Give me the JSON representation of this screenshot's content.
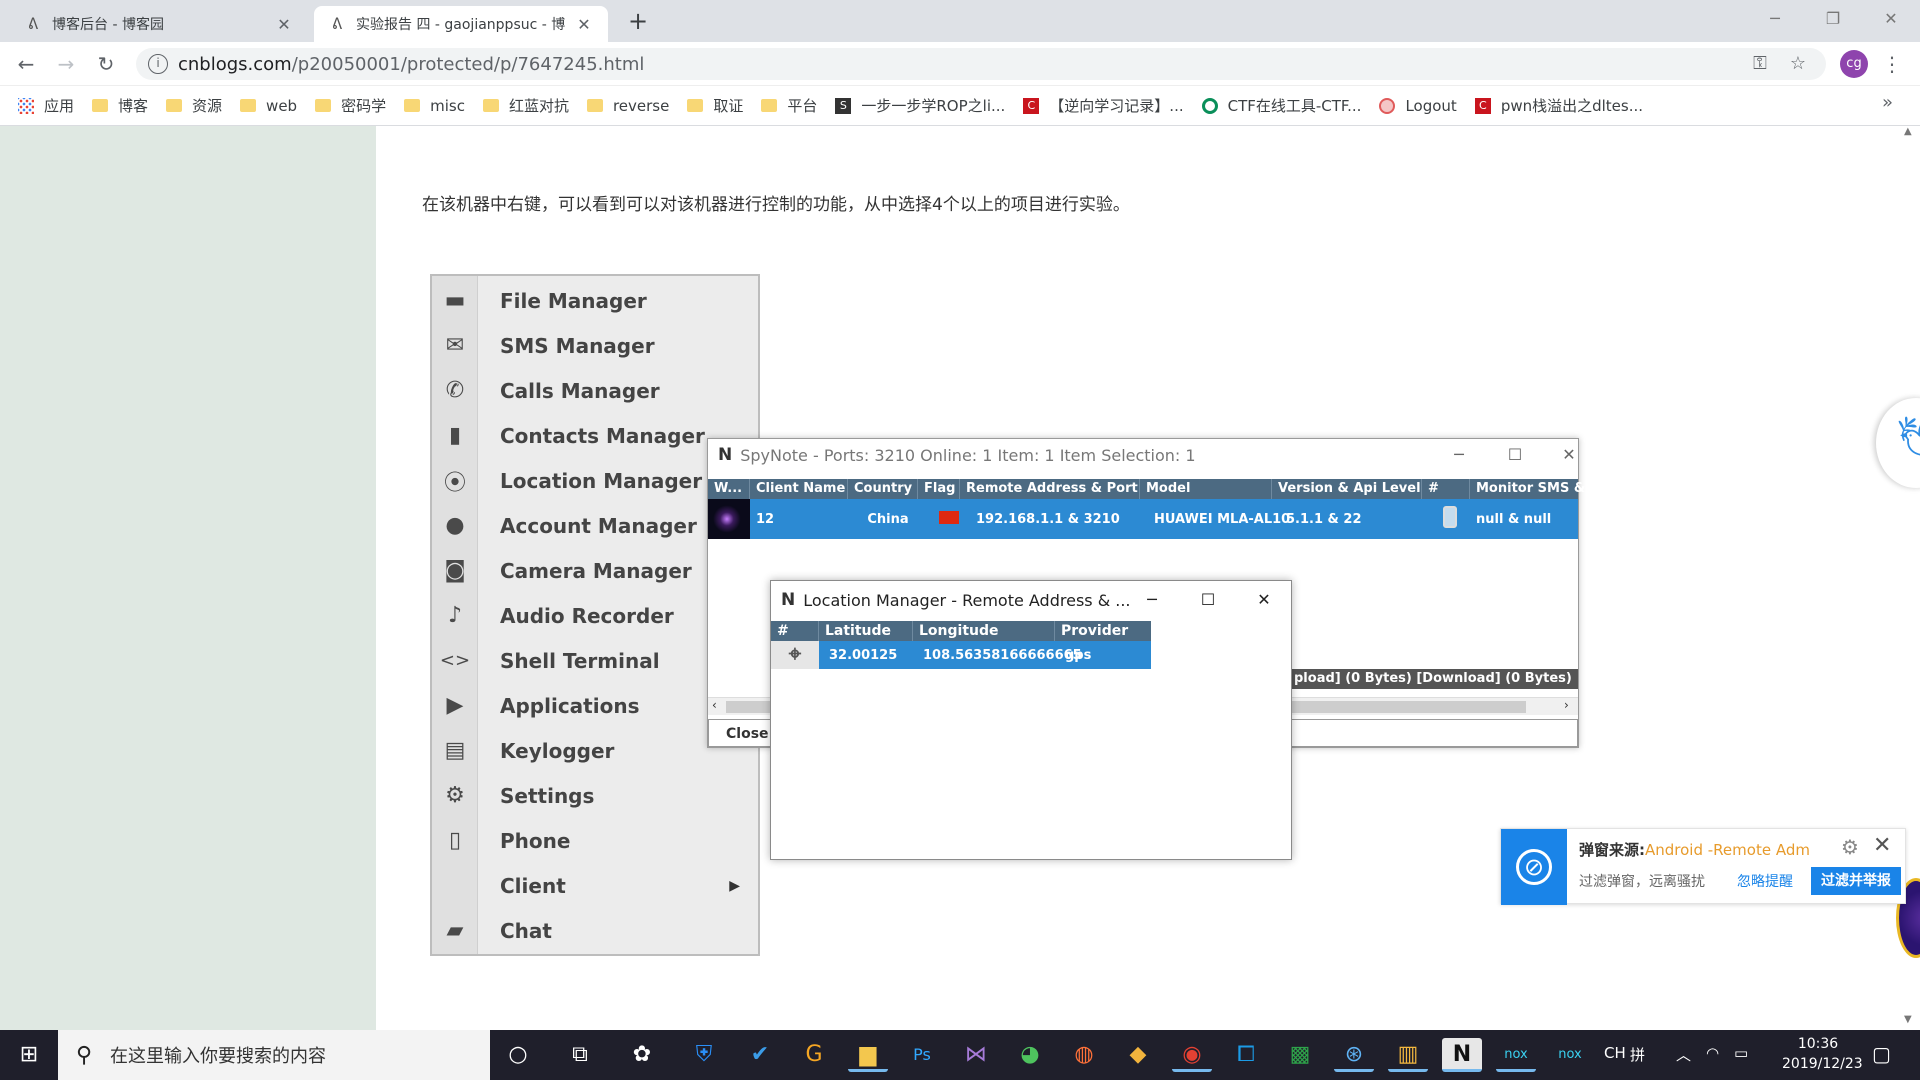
{
  "browser": {
    "tabs": [
      {
        "title": "博客后台 - 博客园",
        "active": false
      },
      {
        "title": "实验报告 四 - gaojianppsuc - 博",
        "active": true
      }
    ],
    "url_domain": "cnblogs.com",
    "url_path": "/p20050001/protected/p/7647245.html",
    "avatar": "cg",
    "bookmarks": [
      "应用",
      "博客",
      "资源",
      "web",
      "密码学",
      "misc",
      "红蓝对抗",
      "reverse",
      "取证",
      "平台",
      "一步一步学ROP之li...",
      "【逆向学习记录】...",
      "CTF在线工具-CTF...",
      "Logout",
      "pwn栈溢出之dltes..."
    ]
  },
  "article": {
    "paragraph": "在该机器中右键，可以看到可以对该机器进行控制的功能，从中选择4个以上的项目进行实验。"
  },
  "context_menu": {
    "items": [
      {
        "label": "File Manager",
        "icon": "folder-icon"
      },
      {
        "label": "SMS Manager",
        "icon": "envelope-icon"
      },
      {
        "label": "Calls Manager",
        "icon": "phone-handset-icon"
      },
      {
        "label": "Contacts Manager",
        "icon": "contacts-book-icon"
      },
      {
        "label": "Location Manager",
        "icon": "map-pin-icon"
      },
      {
        "label": "Account Manager",
        "icon": "person-icon"
      },
      {
        "label": "Camera Manager",
        "icon": "camera-icon"
      },
      {
        "label": "Audio Recorder",
        "icon": "microphone-icon"
      },
      {
        "label": "Shell Terminal",
        "icon": "code-brackets-icon"
      },
      {
        "label": "Applications",
        "icon": "play-store-icon"
      },
      {
        "label": "Keylogger",
        "icon": "keyboard-icon"
      },
      {
        "label": "Settings",
        "icon": "gear-icon"
      },
      {
        "label": "Phone",
        "icon": "mobile-phone-icon"
      },
      {
        "label": "Client",
        "icon": "none"
      },
      {
        "label": "Chat",
        "icon": "chat-bubble-icon"
      }
    ]
  },
  "spynote": {
    "logo": "N",
    "title": "SpyNote - Ports: 3210 Online: 1 Item: 1 Item Selection: 1",
    "columns": [
      "W...",
      "Client Name",
      "Country",
      "Flag",
      "Remote Address & Port",
      "Model",
      "Version & Api Level",
      "#",
      "Monitor SMS &"
    ],
    "row": {
      "client_name": "12",
      "country": "China",
      "remote": "192.168.1.1 & 3210",
      "model": "HUAWEI MLA-AL10",
      "version": "5.1.1 & 22",
      "monitor": "null & null"
    },
    "status": "pload] (0 Bytes) [Download] (0 Bytes)",
    "close_label": "Close"
  },
  "location_manager": {
    "title": "Location Manager - Remote Address & ...",
    "columns": [
      "#",
      "Latitude",
      "Longitude",
      "Provider"
    ],
    "row": {
      "latitude": "32.00125",
      "longitude": "108.56358166666665",
      "provider": "gps"
    }
  },
  "popup": {
    "source_label": "弹窗来源:",
    "source_value": "Android -Remote Adm",
    "description": "过滤弹窗，远离骚扰",
    "ignore": "忽略提醒",
    "report": "过滤并举报"
  },
  "taskbar": {
    "search_placeholder": "在这里输入你要搜索的内容",
    "ime": "CH",
    "time": "10:36",
    "date": "2019/12/23"
  }
}
